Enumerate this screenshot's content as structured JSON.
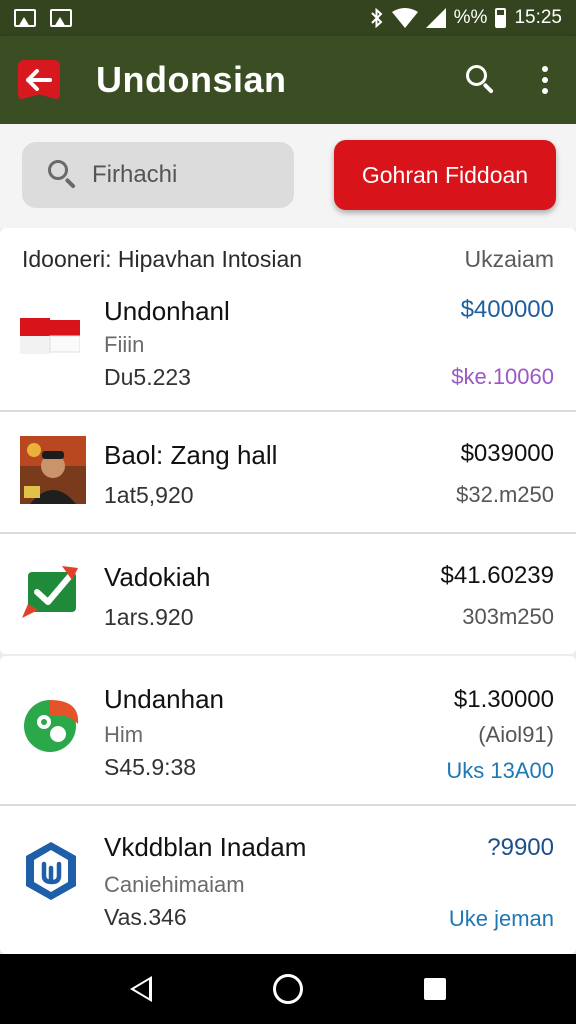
{
  "status_bar": {
    "signal_text": "%%",
    "time": "15:25",
    "icons": [
      "image-icon",
      "image-icon",
      "bluetooth-icon",
      "wifi-icon",
      "signal-icon",
      "battery-icon"
    ]
  },
  "app_bar": {
    "title": "Undonsian",
    "brand_color": "#3b4d22",
    "accent_color": "#d7191f"
  },
  "search": {
    "placeholder": "Firhachi"
  },
  "cta": {
    "label": "Gohran Fiddoan"
  },
  "list_header": {
    "left": "Idooneri: Hipavhan Intosian",
    "right": "Ukzaiam"
  },
  "items": [
    {
      "title": "Undonhanl",
      "sub": "Fiiin",
      "code": "Du5.223",
      "amount": "$400000",
      "amount_color": "#1f5e9e",
      "note": "$ke.10060",
      "note_color": "#9b59c4",
      "icon": "flag-icon"
    },
    {
      "title": "Baol: Zang hall",
      "sub": "",
      "code": "1at5,920",
      "amount": "$039000",
      "amount_color": "#111111",
      "note": "$32.m250",
      "note_color": "#555555",
      "icon": "avatar-photo"
    },
    {
      "title": "Vadokiah",
      "sub": "",
      "code": "1ars.920",
      "amount": "$41.60239",
      "amount_color": "#111111",
      "note": "303m250",
      "note_color": "#555555",
      "icon": "check-icon"
    },
    {
      "title": "Undanhan",
      "sub": "Him",
      "code": "S45.9:38",
      "amount": "$1.30000",
      "amount_color": "#111111",
      "note": "(Aiol91)",
      "note_color": "#555555",
      "extra": "Uks 13A00",
      "extra_color": "#1f78b4",
      "icon": "leaf-logo-icon"
    },
    {
      "title": "Vkddblan Inadam",
      "sub": "Caniehimaiam",
      "code": "Vas.346",
      "amount": "?9900",
      "amount_color": "#1f4e8c",
      "note": "Uke jeman",
      "note_color": "#1f78b4",
      "icon": "shield-icon"
    }
  ]
}
